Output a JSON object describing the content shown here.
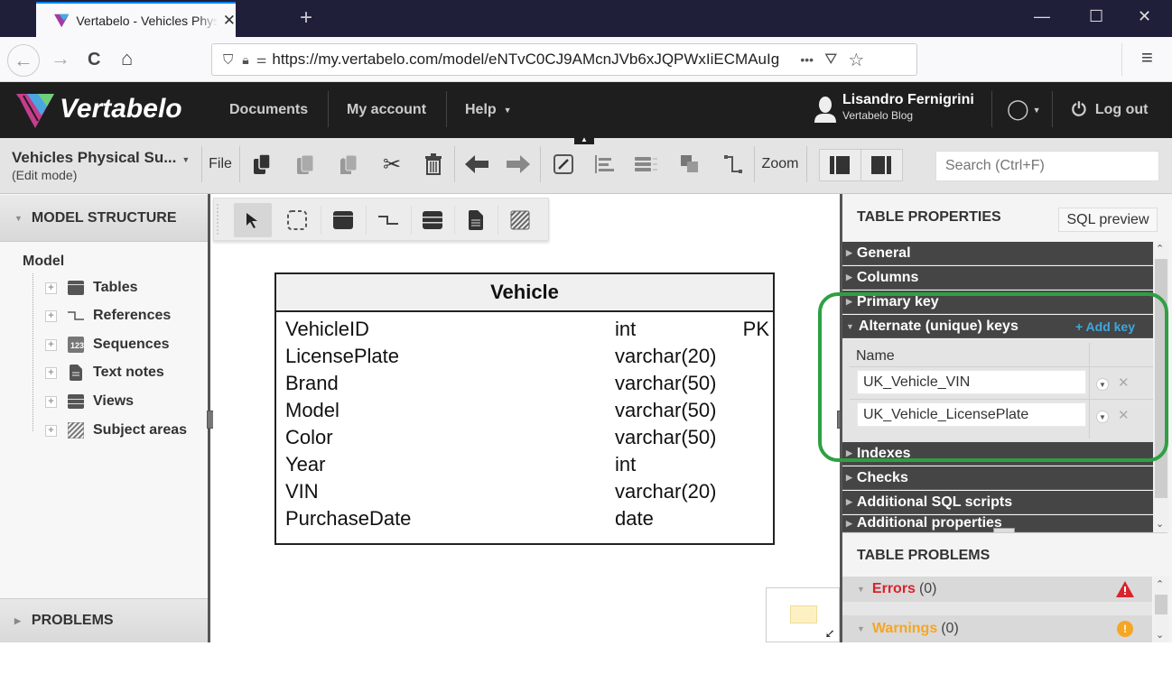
{
  "browser": {
    "tab_title": "Vertabelo - Vehicles Physical Su",
    "url": "https://my.vertabelo.com/model/eNTvC0CJ9AMcnJVb6xJQPWxIiECMAuIg",
    "new_tab": "+",
    "url_more": "•••",
    "icons": {
      "back": "←",
      "forward": "→",
      "reload": "C",
      "home": "⌂",
      "menu": "≡",
      "star": "☆",
      "minimize": "—",
      "maximize": "☐",
      "close": "✕"
    }
  },
  "header": {
    "logo": "Vertabelo",
    "nav": [
      "Documents",
      "My account",
      "Help"
    ],
    "user_name": "Lisandro Fernigrini",
    "user_org": "Vertabelo Blog",
    "logout": "Log out"
  },
  "toolbar": {
    "doc_title": "Vehicles Physical Su...",
    "doc_mode": "(Edit mode)",
    "file": "File",
    "zoom": "Zoom",
    "search_placeholder": "Search (Ctrl+F)"
  },
  "left_panel": {
    "title": "MODEL STRUCTURE",
    "root": "Model",
    "items": [
      "Tables",
      "References",
      "Sequences",
      "Text notes",
      "Views",
      "Subject areas"
    ],
    "problems": "PROBLEMS"
  },
  "entity": {
    "name": "Vehicle",
    "columns": [
      {
        "name": "VehicleID",
        "type": "int",
        "key": "PK"
      },
      {
        "name": "LicensePlate",
        "type": "varchar(20)",
        "key": ""
      },
      {
        "name": "Brand",
        "type": "varchar(50)",
        "key": ""
      },
      {
        "name": "Model",
        "type": "varchar(50)",
        "key": ""
      },
      {
        "name": "Color",
        "type": "varchar(50)",
        "key": ""
      },
      {
        "name": "Year",
        "type": "int",
        "key": ""
      },
      {
        "name": "VIN",
        "type": "varchar(20)",
        "key": ""
      },
      {
        "name": "PurchaseDate",
        "type": "date",
        "key": ""
      }
    ]
  },
  "right_panel": {
    "title": "TABLE PROPERTIES",
    "sql_preview": "SQL preview",
    "sections": [
      "General",
      "Columns",
      "Primary key",
      "Alternate (unique) keys",
      "Indexes",
      "Checks",
      "Additional SQL scripts",
      "Additional properties"
    ],
    "add_key": "+ Add key",
    "ak_header": "Name",
    "alternate_keys": [
      "UK_Vehicle_VIN",
      "UK_Vehicle_LicensePlate"
    ],
    "problems_title": "TABLE PROBLEMS",
    "errors_label": "Errors",
    "errors_count": "(0)",
    "warnings_label": "Warnings",
    "warnings_count": "(0)",
    "colors": {
      "errors": "#d9232d",
      "warnings": "#f5a623",
      "add_key": "#3ca9e0",
      "highlight": "#2ea043"
    }
  }
}
